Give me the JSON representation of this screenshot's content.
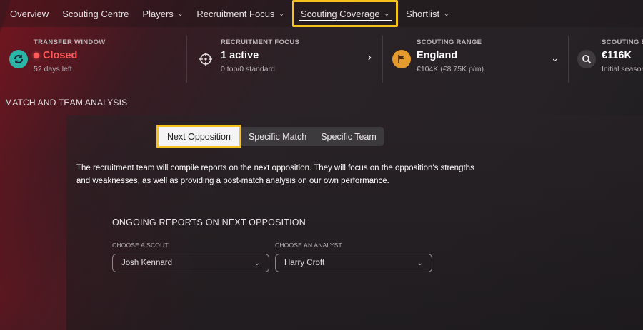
{
  "nav": {
    "items": [
      {
        "label": "Overview"
      },
      {
        "label": "Scouting Centre"
      },
      {
        "label": "Players"
      },
      {
        "label": "Recruitment Focus"
      },
      {
        "label": "Scouting Coverage"
      },
      {
        "label": "Shortlist"
      }
    ]
  },
  "info": {
    "transfer_window": {
      "label": "TRANSFER WINDOW",
      "value": "Closed",
      "sub": "52 days left"
    },
    "recruitment_focus": {
      "label": "RECRUITMENT FOCUS",
      "value": "1 active",
      "sub": "0 top/0 standard"
    },
    "scouting_range": {
      "label": "SCOUTING RANGE",
      "value": "England",
      "sub": "€104K (€8.75K p/m)"
    },
    "scouting_budget": {
      "label": "SCOUTING B",
      "value": "€116K",
      "sub": "Initial season"
    }
  },
  "section_title": "MATCH AND TEAM ANALYSIS",
  "tabs": {
    "next_opposition": "Next Opposition",
    "specific_match": "Specific Match",
    "specific_team": "Specific Team"
  },
  "description": "The recruitment team will compile reports on the next opposition. They will focus on the opposition's strengths and weaknesses, as well as providing a post-match analysis on our own performance.",
  "reports": {
    "title": "ONGOING REPORTS ON NEXT OPPOSITION",
    "scout_label": "CHOOSE A SCOUT",
    "scout_value": "Josh Kennard",
    "analyst_label": "CHOOSE AN ANALYST",
    "analyst_value": "Harry Croft"
  },
  "colors": {
    "highlight": "#f4c21a",
    "closed": "#ff5a5a",
    "transfer_icon": "#2bb5a6",
    "range_icon": "#e59a2e"
  }
}
